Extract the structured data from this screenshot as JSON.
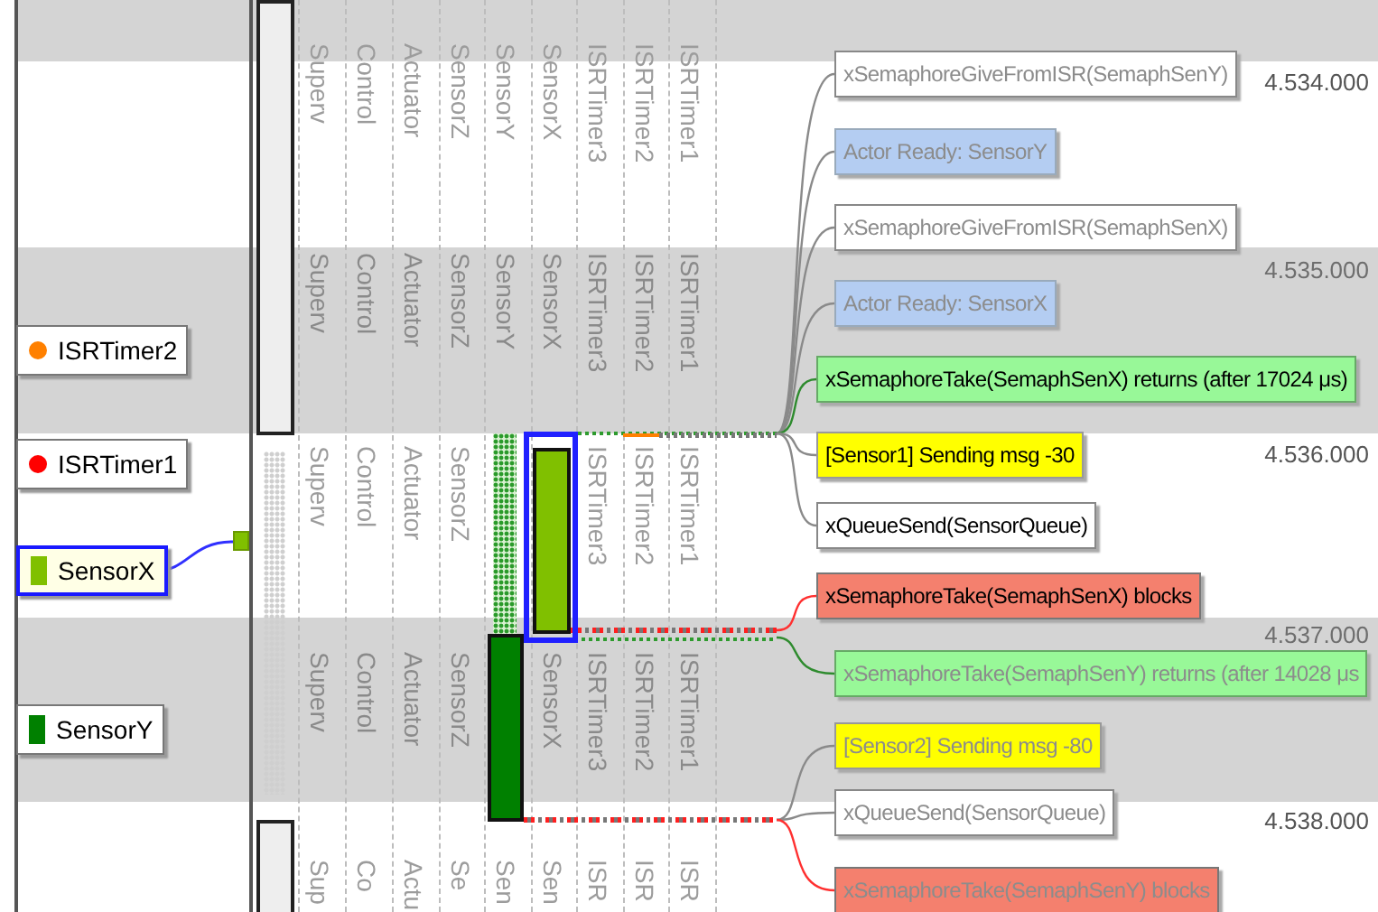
{
  "actors": [
    {
      "name": "ISRTimer2",
      "kind": "isr",
      "color": "#ff8000",
      "selected": false
    },
    {
      "name": "ISRTimer1",
      "kind": "isr",
      "color": "#ff0000",
      "selected": false
    },
    {
      "name": "SensorX",
      "kind": "task",
      "color": "#80c000",
      "selected": true
    },
    {
      "name": "SensorY",
      "kind": "task",
      "color": "#008000",
      "selected": false
    }
  ],
  "lane_label_rows": [
    [
      "Superv",
      "Control",
      "Actuator",
      "SensorZ",
      "SensorY",
      "SensorX",
      "ISRTimer3",
      "ISRTimer2",
      "ISRTimer1"
    ],
    [
      "Superv",
      "Control",
      "Actuator",
      "SensorZ",
      "SensorY",
      "SensorX",
      "ISRTimer3",
      "ISRTimer2",
      "ISRTimer1"
    ],
    [
      "Superv",
      "Control",
      "Actuator",
      "SensorZ",
      null,
      null,
      "ISRTimer3",
      "ISRTimer2",
      "ISRTimer1"
    ],
    [
      "Superv",
      "Control",
      "Actuator",
      "SensorZ",
      null,
      "SensorX",
      "ISRTimer3",
      "ISRTimer2",
      "ISRTimer1"
    ],
    [
      "Sup",
      "Co",
      "Actu",
      "Se",
      "Sen",
      "Sen",
      "ISR",
      "ISR",
      "ISR"
    ]
  ],
  "timestamps": [
    {
      "text": "4.534.000",
      "shaded": false
    },
    {
      "text": "4.535.000",
      "shaded": true
    },
    {
      "text": "4.536.000",
      "shaded": false
    },
    {
      "text": "4.537.000",
      "shaded": true
    },
    {
      "text": "4.538.000",
      "shaded": false
    }
  ],
  "events": [
    {
      "text": "xSemaphoreGiveFromISR(SemaphSenY)",
      "kind": "call",
      "dimmed": true
    },
    {
      "text": "Actor Ready: SensorY",
      "kind": "ready",
      "dimmed": true
    },
    {
      "text": "xSemaphoreGiveFromISR(SemaphSenX)",
      "kind": "call",
      "dimmed": true
    },
    {
      "text": "Actor Ready: SensorX",
      "kind": "ready",
      "dimmed": true
    },
    {
      "text": "xSemaphoreTake(SemaphSenX) returns (after 17024 μs)",
      "kind": "returns",
      "dimmed": false
    },
    {
      "text": "[Sensor1] Sending msg -30",
      "kind": "user",
      "dimmed": false
    },
    {
      "text": "xQueueSend(SensorQueue)",
      "kind": "call",
      "dimmed": false
    },
    {
      "text": "xSemaphoreTake(SemaphSenX) blocks",
      "kind": "blocks",
      "dimmed": false
    },
    {
      "text": "xSemaphoreTake(SemaphSenY) returns (after 14028 μs",
      "kind": "returns",
      "dimmed": true
    },
    {
      "text": "[Sensor2] Sending msg -80",
      "kind": "user",
      "dimmed": true
    },
    {
      "text": "xQueueSend(SensorQueue)",
      "kind": "call",
      "dimmed": true
    },
    {
      "text": "xSemaphoreTake(SemaphSenY) blocks",
      "kind": "blocks",
      "dimmed": true
    }
  ]
}
